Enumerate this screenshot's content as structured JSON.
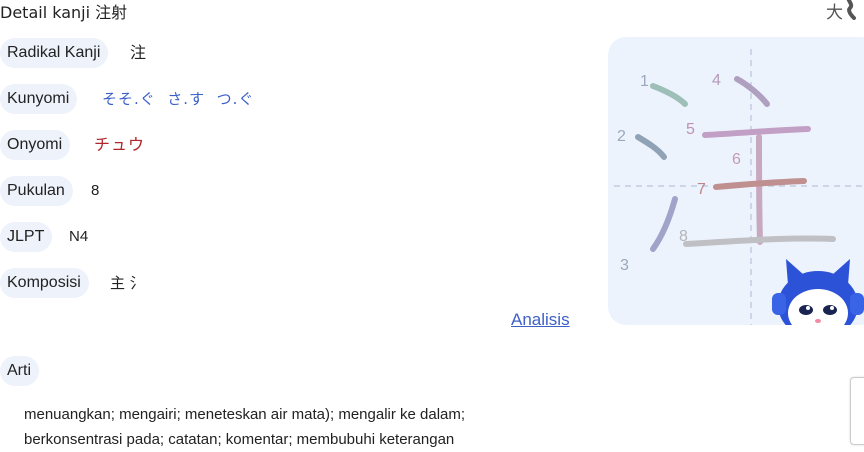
{
  "header": {
    "title": "Detail kanji 注射",
    "top_icon_char": "大"
  },
  "rows": [
    {
      "label": "Radikal Kanji",
      "value": "注"
    },
    {
      "label": "Kunyomi",
      "value": "そそ.ぐ  さ.す  つ.ぐ"
    },
    {
      "label": "Onyomi",
      "value": "チュウ"
    },
    {
      "label": "Pukulan",
      "value": "8"
    },
    {
      "label": "JLPT",
      "value": "N4"
    },
    {
      "label": "Komposisi",
      "value": "主 氵"
    }
  ],
  "analisis_link": "Analisis",
  "arti": {
    "label": "Arti",
    "text": "menuangkan; mengairi; meneteskan air mata); mengalir ke dalam; berkonsentrasi pada; catatan; komentar; membubuhi keterangan"
  },
  "stroke_numbers": [
    "1",
    "2",
    "3",
    "4",
    "5",
    "6",
    "7",
    "8"
  ],
  "colors": {
    "pill_bg": "#eef2fb",
    "link_blue": "#3d5fc6",
    "kunyomi_blue": "#3a5fc8",
    "onyomi_red": "#b0262a",
    "canvas_bg": "#edf3fd",
    "mascot_blue": "#2c52d8"
  }
}
